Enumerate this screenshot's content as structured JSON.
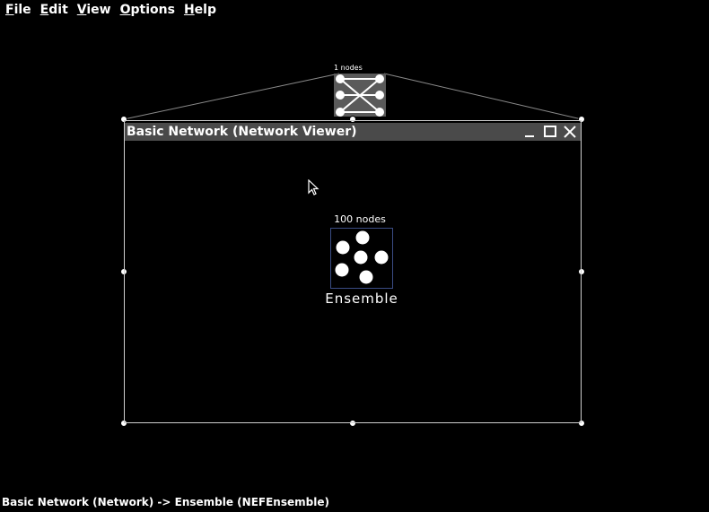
{
  "menu": {
    "file": {
      "mnemonic": "F",
      "rest": "ile"
    },
    "edit": {
      "mnemonic": "E",
      "rest": "dit"
    },
    "view": {
      "mnemonic": "V",
      "rest": "iew"
    },
    "options": {
      "mnemonic": "O",
      "rest": "ptions"
    },
    "help": {
      "mnemonic": "H",
      "rest": "elp"
    }
  },
  "network_icon": {
    "count_label": "1 nodes",
    "icon": "network-icon"
  },
  "viewer": {
    "title": "Basic Network (Network Viewer)",
    "minimize_icon": "minimize-icon",
    "maximize_icon": "maximize-icon",
    "close_icon": "close-icon"
  },
  "ensemble": {
    "count_label": "100 nodes",
    "name": "Ensemble",
    "icon": "ensemble-icon"
  },
  "status": {
    "text": "Basic Network (Network) -> Ensemble (NEFEnsemble)"
  },
  "cursor_icon": "mouse-pointer-icon",
  "colors": {
    "background": "#000000",
    "titlebar": "#4a4a4a",
    "frame": "#cfcfcf",
    "ensemble_border": "#3a4c84",
    "text": "#ffffff"
  }
}
